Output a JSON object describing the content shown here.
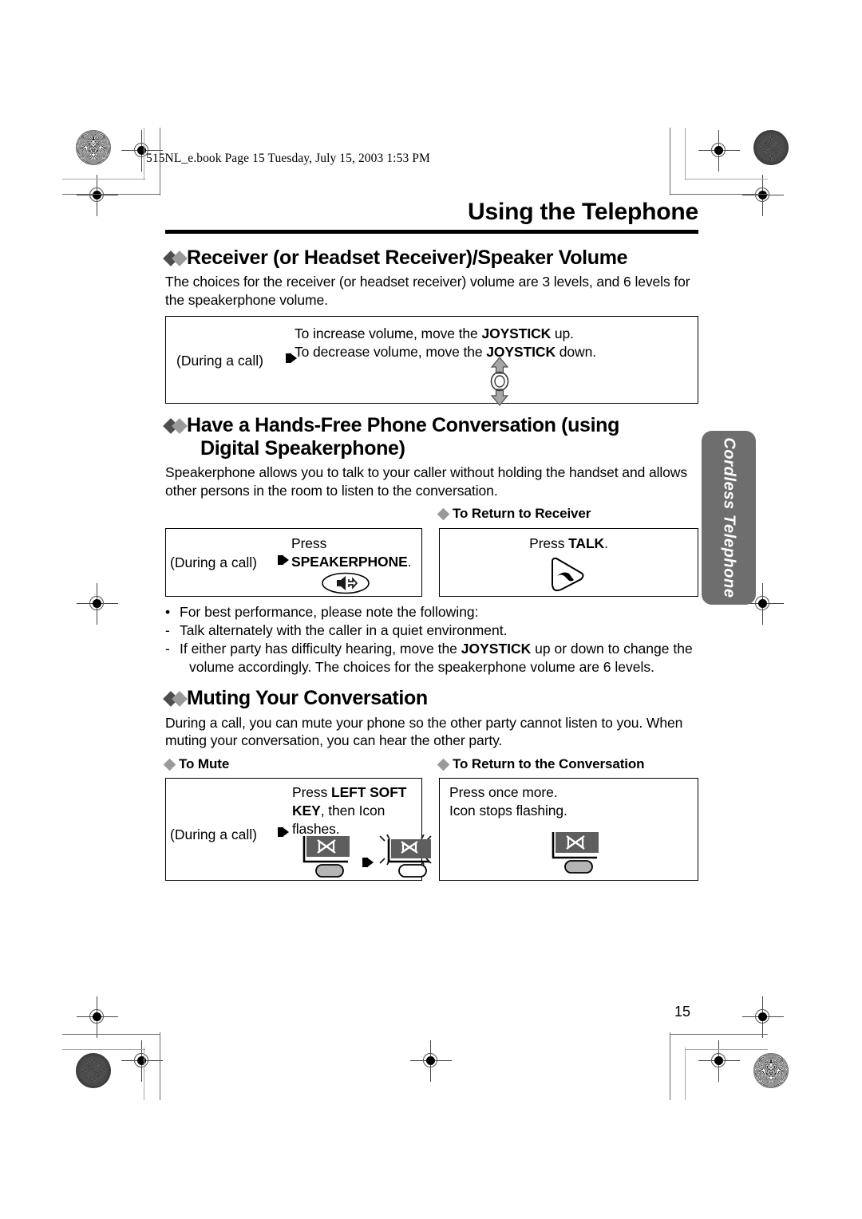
{
  "print_note": "515NL_e.book  Page 15  Tuesday, July 15, 2003  1:53 PM",
  "chapter_title": "Using the Telephone",
  "side_tab": {
    "label": "Cordless Telephone"
  },
  "page_number": "15",
  "colors": {
    "diamond_dark": "#4d4d4d",
    "diamond_light": "#9a9a9a",
    "side_tab_bg": "#6e6e6e",
    "icon_gray": "#a6a6a6",
    "lcd_panel": "#5e5e5e"
  },
  "sections": [
    {
      "heading": "Receiver (or Headset Receiver)/Speaker Volume",
      "intro": "The choices for the receiver (or headset receiver) volume are 3 levels, and 6 levels for the speakerphone volume.",
      "box": {
        "during_label": "(During a call)",
        "line1_a": "To increase volume, move the ",
        "line1_b": "JOYSTICK",
        "line1_c": " up.",
        "line2_a": "To decrease volume, move the ",
        "line2_b": "JOYSTICK",
        "line2_c": " down.",
        "icon": "joystick-up-down-icon"
      }
    },
    {
      "heading_line1": "Have a Hands-Free Phone Conversation (using",
      "heading_line2": "Digital Speakerphone)",
      "intro": "Speakerphone allows you to talk to your caller without holding the handset and allows other persons in the room to listen to the conversation.",
      "right_subhead": "To Return to Receiver",
      "left_box": {
        "during_label": "(During a call)",
        "line1": "Press",
        "line2_bold": "SPEAKERPHONE",
        "line2_tail": ".",
        "icon": "speakerphone-key-icon"
      },
      "right_box": {
        "line1_a": "Press ",
        "line1_b": "TALK",
        "line1_c": ".",
        "icon": "talk-key-icon"
      },
      "notes": [
        {
          "marker": "•",
          "text": "For best performance, please note the following:"
        },
        {
          "marker": "-",
          "text": "Talk alternately with the caller in a quiet environment."
        },
        {
          "marker": "-",
          "text_a": "If either party has difficulty hearing, move the ",
          "text_b": "JOYSTICK",
          "text_c": " up or down to change the",
          "cont": "volume accordingly. The choices for the speakerphone volume are 6 levels."
        }
      ]
    },
    {
      "heading": "Muting Your Conversation",
      "intro": "During a call, you can mute your phone so the other party cannot listen to you. When muting your conversation, you can hear the other party.",
      "left_subhead": "To Mute",
      "right_subhead": "To Return to the Conversation",
      "left_box": {
        "during_label": "(During a call)",
        "line1_a": "Press ",
        "line1_b": "LEFT SOFT",
        "line2_b": "KEY",
        "line2_c": ", then Icon",
        "line3": "flashes.",
        "icon_1": "mute-icon-static",
        "icon_2": "mute-icon-flashing"
      },
      "right_box": {
        "line1": "Press once more.",
        "line2": "Icon stops flashing.",
        "icon": "mute-icon-static"
      }
    }
  ]
}
